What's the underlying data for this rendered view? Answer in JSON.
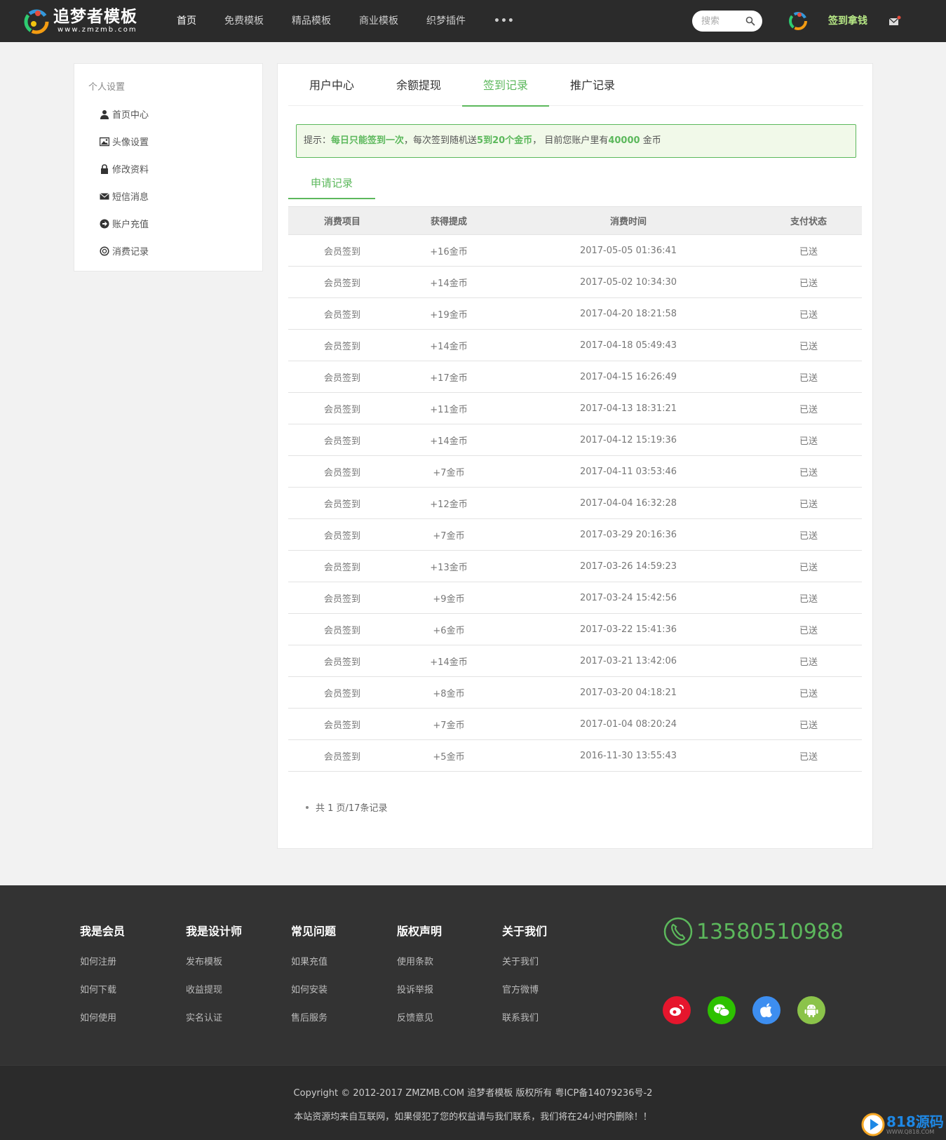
{
  "header": {
    "logo_title": "追梦者模板",
    "logo_sub": "www.zmzmb.com",
    "nav": [
      "首页",
      "免费模板",
      "精品模板",
      "商业模板",
      "织梦插件",
      "•••"
    ],
    "search_placeholder": "搜索",
    "signin_label": "签到拿钱"
  },
  "sidebar": {
    "title": "个人设置",
    "items": [
      {
        "label": "首页中心",
        "icon": "user-icon"
      },
      {
        "label": "头像设置",
        "icon": "image-icon"
      },
      {
        "label": "修改资料",
        "icon": "lock-icon"
      },
      {
        "label": "短信消息",
        "icon": "envelope-icon"
      },
      {
        "label": "账户充值",
        "icon": "arrow-circle-icon"
      },
      {
        "label": "消费记录",
        "icon": "coin-icon"
      }
    ]
  },
  "main": {
    "tabs": [
      "用户中心",
      "余额提现",
      "签到记录",
      "推广记录"
    ],
    "active_tab": 2,
    "notice": {
      "prefix": "提示：",
      "part1": "每日只能签到一次",
      "part2": "，每次签到随机送",
      "part3": "5到20个金币",
      "part4": "，  目前您账户里有",
      "balance": "40000",
      "part5": " 金币"
    },
    "subtab": "申请记录",
    "columns": [
      "消费项目",
      "获得提成",
      "消费时间",
      "支付状态"
    ],
    "rows": [
      [
        "会员签到",
        "+16金币",
        "2017-05-05 01:36:41",
        "已送"
      ],
      [
        "会员签到",
        "+14金币",
        "2017-05-02 10:34:30",
        "已送"
      ],
      [
        "会员签到",
        "+19金币",
        "2017-04-20 18:21:58",
        "已送"
      ],
      [
        "会员签到",
        "+14金币",
        "2017-04-18 05:49:43",
        "已送"
      ],
      [
        "会员签到",
        "+17金币",
        "2017-04-15 16:26:49",
        "已送"
      ],
      [
        "会员签到",
        "+11金币",
        "2017-04-13 18:31:21",
        "已送"
      ],
      [
        "会员签到",
        "+14金币",
        "2017-04-12 15:19:36",
        "已送"
      ],
      [
        "会员签到",
        "+7金币",
        "2017-04-11 03:53:46",
        "已送"
      ],
      [
        "会员签到",
        "+12金币",
        "2017-04-04 16:32:28",
        "已送"
      ],
      [
        "会员签到",
        "+7金币",
        "2017-03-29 20:16:36",
        "已送"
      ],
      [
        "会员签到",
        "+13金币",
        "2017-03-26 14:59:23",
        "已送"
      ],
      [
        "会员签到",
        "+9金币",
        "2017-03-24 15:42:56",
        "已送"
      ],
      [
        "会员签到",
        "+6金币",
        "2017-03-22 15:41:36",
        "已送"
      ],
      [
        "会员签到",
        "+14金币",
        "2017-03-21 13:42:06",
        "已送"
      ],
      [
        "会员签到",
        "+8金币",
        "2017-03-20 04:18:21",
        "已送"
      ],
      [
        "会员签到",
        "+7金币",
        "2017-01-04 08:20:24",
        "已送"
      ],
      [
        "会员签到",
        "+5金币",
        "2016-11-30 13:55:43",
        "已送"
      ]
    ],
    "pager": "共 1 页/17条记录"
  },
  "footer": {
    "columns": [
      {
        "heading": "我是会员",
        "links": [
          "如何注册",
          "如何下载",
          "如何使用"
        ]
      },
      {
        "heading": "我是设计师",
        "links": [
          "发布模板",
          "收益提现",
          "实名认证"
        ]
      },
      {
        "heading": "常见问题",
        "links": [
          "如果充值",
          "如何安装",
          "售后服务"
        ]
      },
      {
        "heading": "版权声明",
        "links": [
          "使用条款",
          "投诉举报",
          "反馈意见"
        ]
      },
      {
        "heading": "关于我们",
        "links": [
          "关于我们",
          "官方微博",
          "联系我们"
        ]
      }
    ],
    "phone": "13580510988",
    "social": [
      {
        "icon": "weibo-icon",
        "color": "#e6162d"
      },
      {
        "icon": "wechat-icon",
        "color": "#2dc100"
      },
      {
        "icon": "apple-icon",
        "color": "#3d8ef0"
      },
      {
        "icon": "android-icon",
        "color": "#8bc34a"
      }
    ],
    "copyright": "Copyright © 2012-2017 ZMZMB.COM 追梦者模板 版权所有 粤ICP备14079236号-2",
    "disclaimer": "本站资源均来自互联网，如果侵犯了您的权益请与我们联系，我们将在24小时内删除！！"
  },
  "watermark": {
    "title": "818源码",
    "sub": "WWW.Q818.COM"
  },
  "colors": {
    "accent": "#5cb85c",
    "header_bg": "#2b2b2b",
    "footer_bg": "#333333",
    "signin": "#b8e986"
  }
}
